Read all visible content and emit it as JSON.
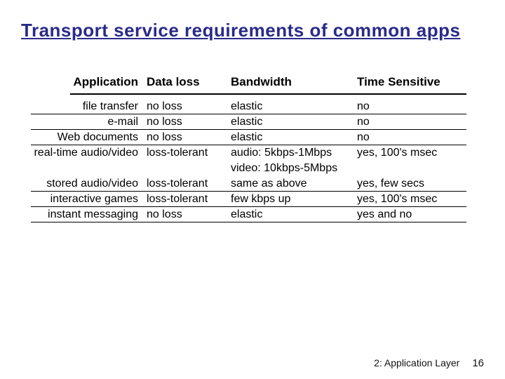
{
  "title": "Transport service requirements of common apps",
  "columns": {
    "app": "Application",
    "loss": "Data loss",
    "bw": "Bandwidth",
    "time": "Time Sensitive"
  },
  "rows": {
    "r0": {
      "app": "file transfer",
      "loss": "no loss",
      "bw": "elastic",
      "time": "no"
    },
    "r1": {
      "app": "e-mail",
      "loss": "no loss",
      "bw": "elastic",
      "time": "no"
    },
    "r2": {
      "app": "Web documents",
      "loss": "no loss",
      "bw": "elastic",
      "time": "no"
    },
    "r3": {
      "app": "real-time audio/video",
      "loss": "loss-tolerant",
      "bw": "audio: 5kbps-1Mbps",
      "time": "yes, 100's msec"
    },
    "r3b": {
      "app": "",
      "loss": "",
      "bw": "video: 10kbps-5Mbps",
      "time": ""
    },
    "r4": {
      "app": "stored audio/video",
      "loss": "loss-tolerant",
      "bw": "same as above",
      "time": "yes, few secs"
    },
    "r5": {
      "app": "interactive games",
      "loss": "loss-tolerant",
      "bw": "few kbps up",
      "time": "yes, 100's msec"
    },
    "r6": {
      "app": "instant messaging",
      "loss": "no loss",
      "bw": "elastic",
      "time": "yes and no"
    }
  },
  "footer": {
    "chapter": "2: Application Layer",
    "page": "16"
  }
}
